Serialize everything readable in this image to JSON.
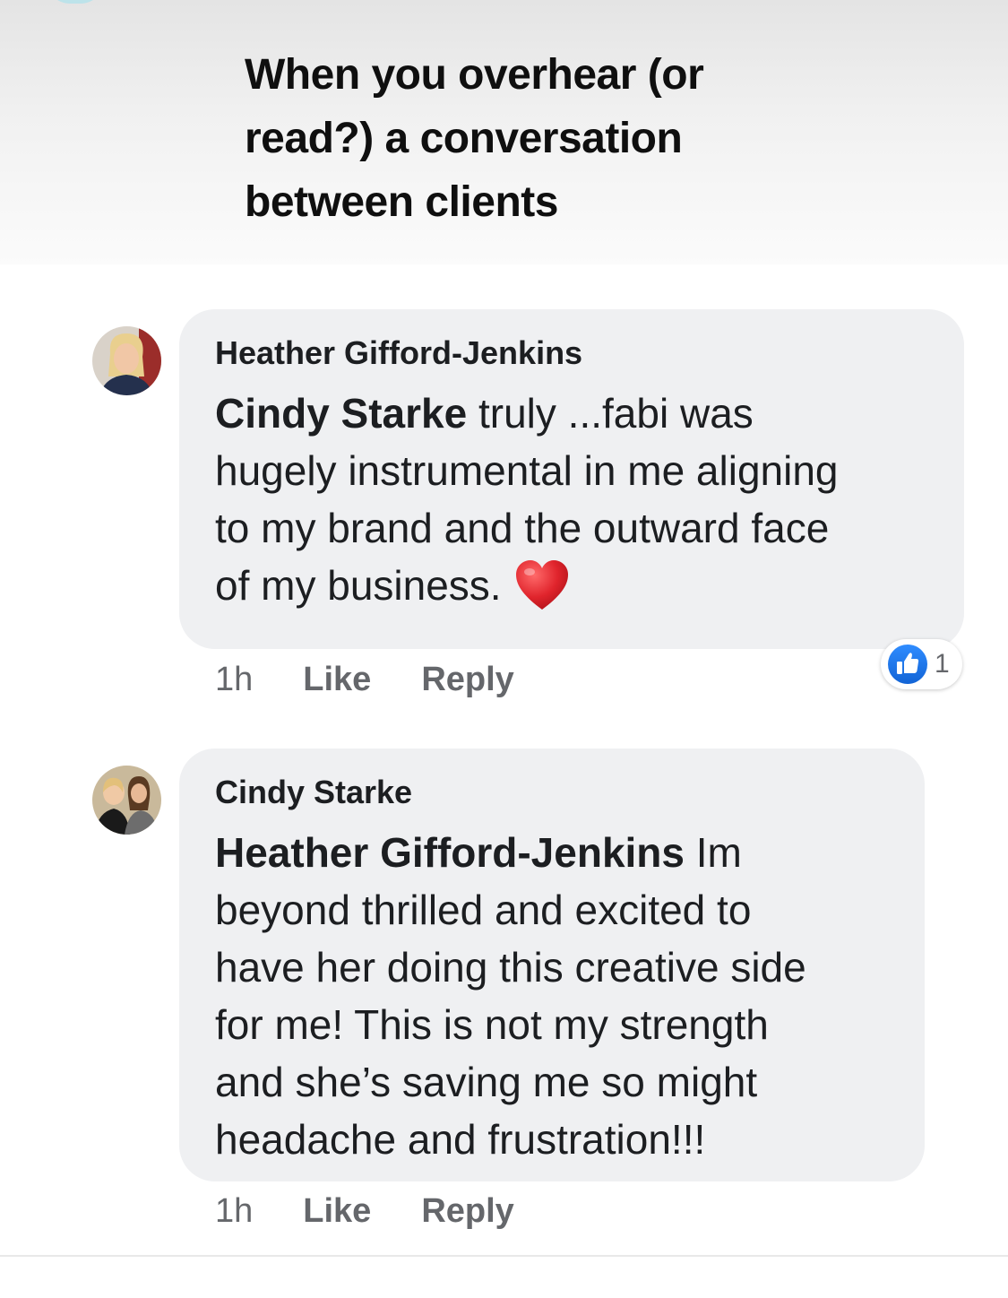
{
  "post": {
    "title": "When you overhear (or\nread?) a conversation\nbetween clients"
  },
  "comments": [
    {
      "author": "Heather Gifford-Jenkins",
      "mention": "Cindy Starke",
      "text": " truly ...fabi was\nhugely instrumental in me aligning\nto my brand and the outward face\nof my business.",
      "emoji": "heart-icon",
      "time": "1h",
      "like_label": "Like",
      "reply_label": "Reply",
      "reaction_count": "1",
      "reaction_icon": "like-icon"
    },
    {
      "author": "Cindy Starke",
      "mention": "Heather Gifford-Jenkins",
      "text": " Im\nbeyond thrilled and excited to\nhave her doing this creative side\nfor me! This is not my strength\nand she’s saving me so might\nheadache and frustration!!!",
      "time": "1h",
      "like_label": "Like",
      "reply_label": "Reply"
    }
  ],
  "colors": {
    "bubble": "#eff0f2",
    "meta_text": "#65676b",
    "like_blue": "#1877f2",
    "heart_red": "#e0242c"
  }
}
